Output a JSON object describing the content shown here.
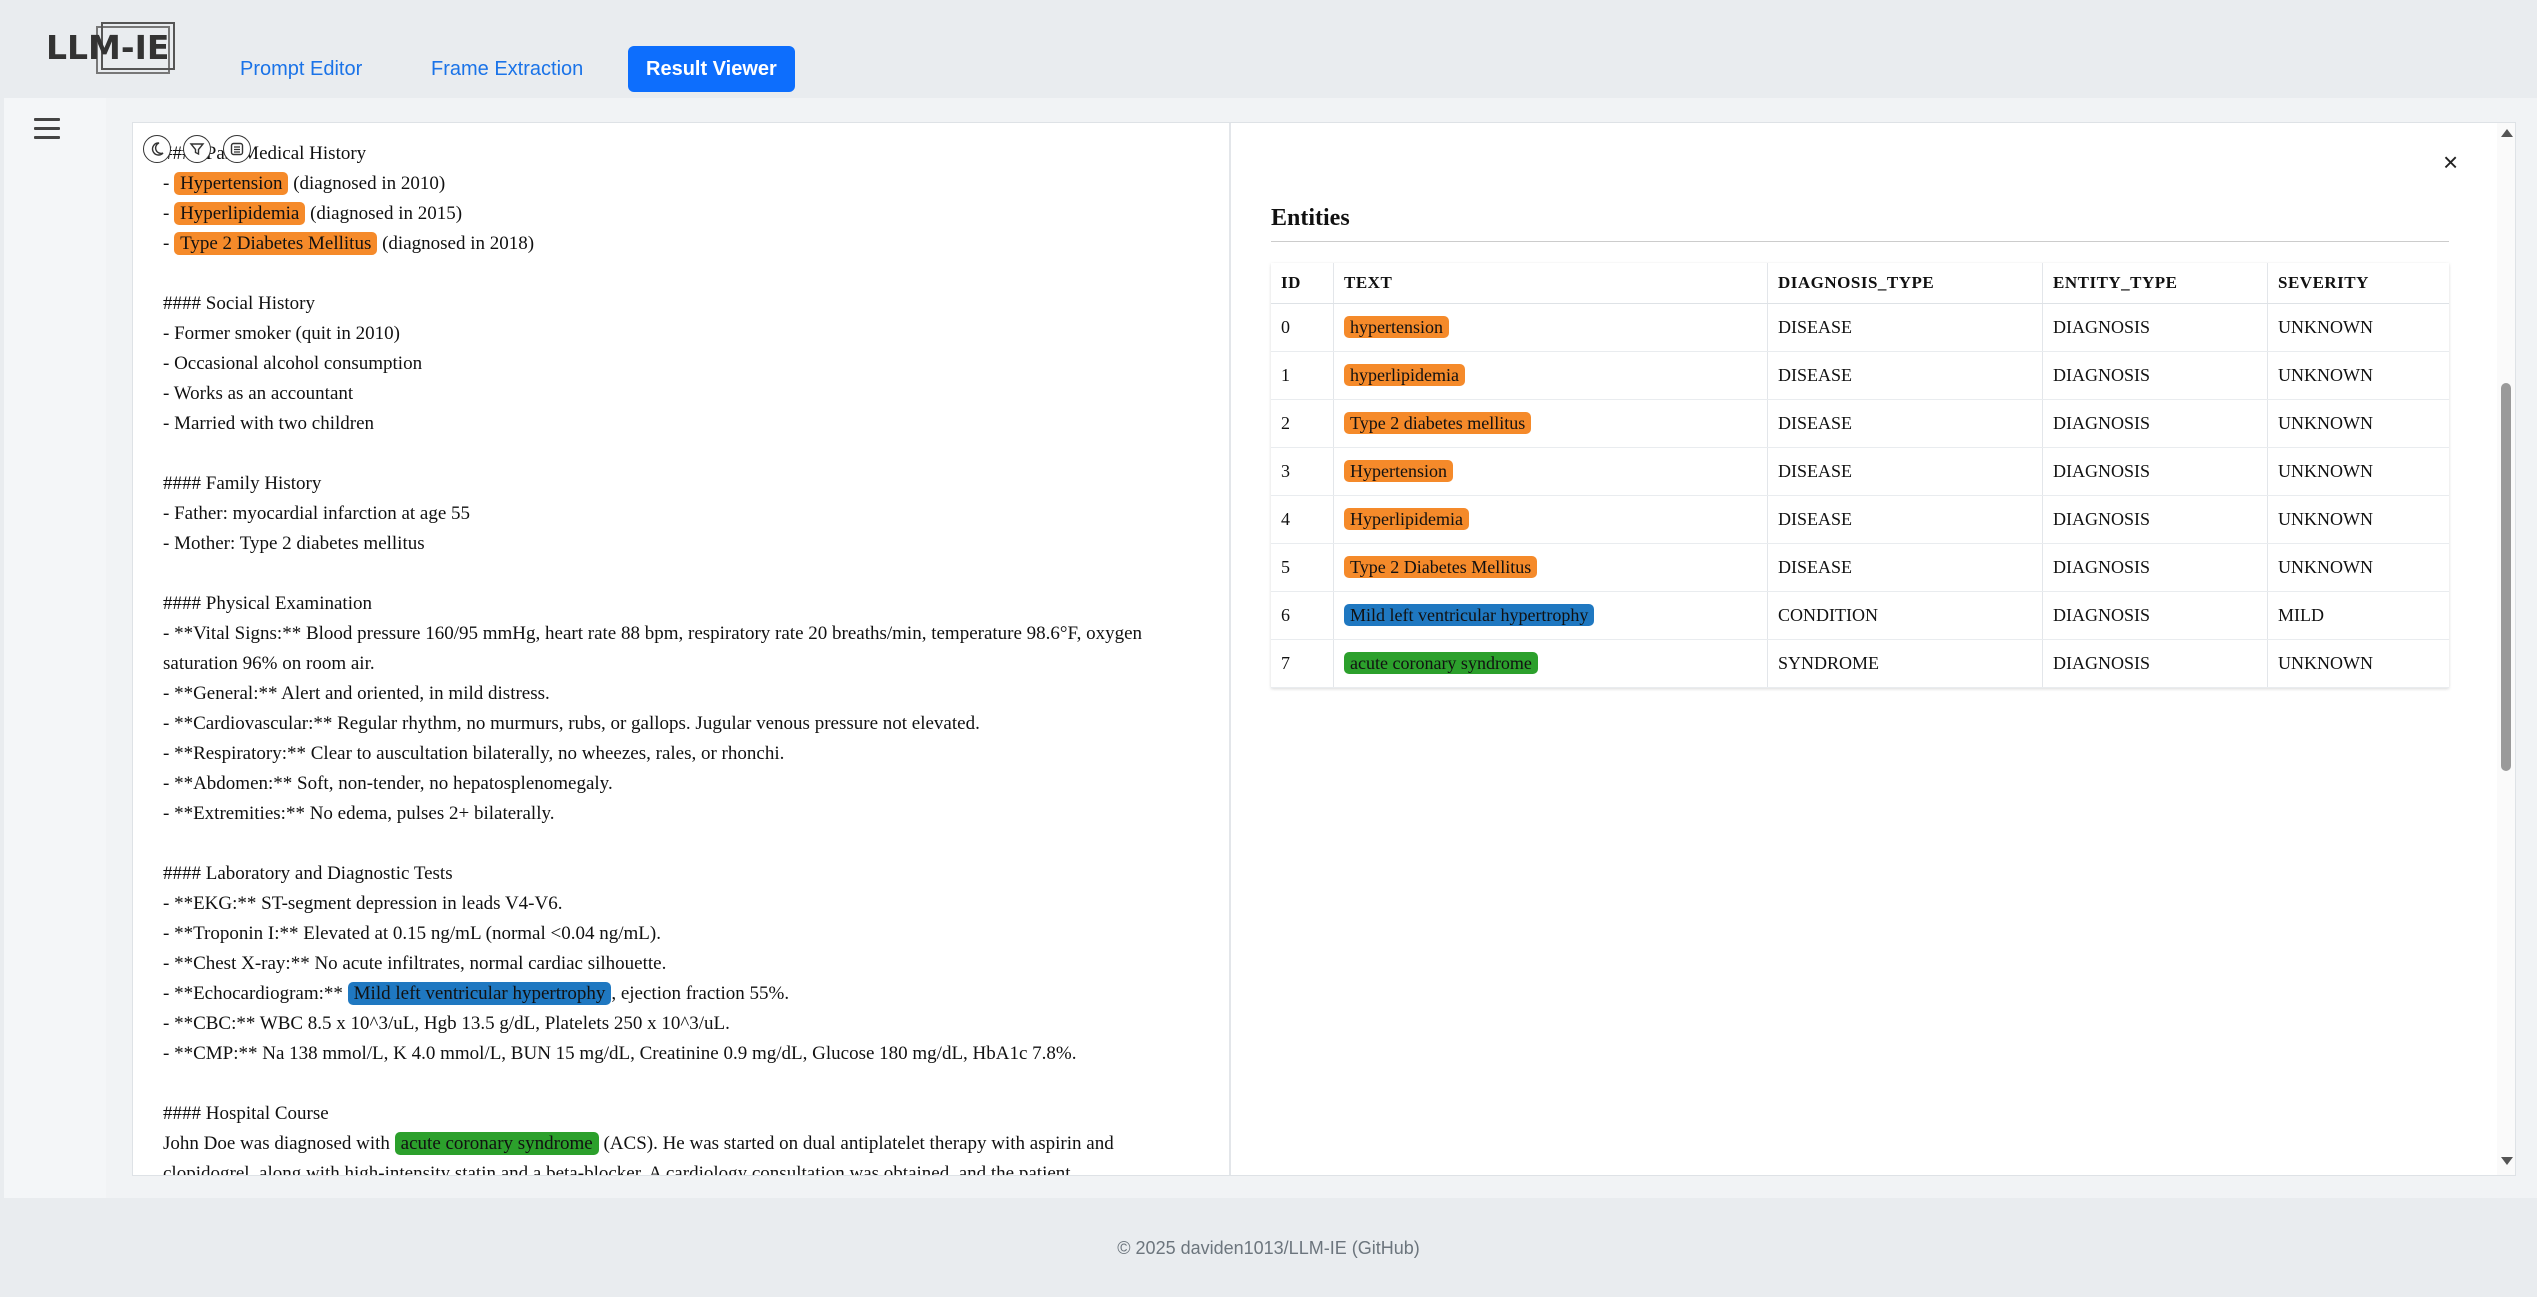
{
  "header": {
    "logo_text": "LLM-IE",
    "tabs": [
      {
        "label": "Prompt Editor",
        "active": false
      },
      {
        "label": "Frame Extraction",
        "active": false
      },
      {
        "label": "Result Viewer",
        "active": true
      }
    ]
  },
  "sidebar": {
    "menu_icon": "hamburger-menu-icon"
  },
  "document_controls": [
    "moon-icon",
    "filter-icon",
    "list-icon"
  ],
  "document": {
    "lines": [
      {
        "segments": [
          {
            "text": "#### Past Medical History"
          }
        ]
      },
      {
        "segments": [
          {
            "text": "- "
          },
          {
            "text": "Hypertension",
            "hl": "orange"
          },
          {
            "text": " (diagnosed in 2010)"
          }
        ]
      },
      {
        "segments": [
          {
            "text": "- "
          },
          {
            "text": "Hyperlipidemia",
            "hl": "orange"
          },
          {
            "text": " (diagnosed in 2015)"
          }
        ]
      },
      {
        "segments": [
          {
            "text": "- "
          },
          {
            "text": "Type 2 Diabetes Mellitus",
            "hl": "orange"
          },
          {
            "text": " (diagnosed in 2018)"
          }
        ]
      },
      {
        "blank": true
      },
      {
        "segments": [
          {
            "text": "#### Social History"
          }
        ]
      },
      {
        "segments": [
          {
            "text": "- Former smoker (quit in 2010)"
          }
        ]
      },
      {
        "segments": [
          {
            "text": "- Occasional alcohol consumption"
          }
        ]
      },
      {
        "segments": [
          {
            "text": "- Works as an accountant"
          }
        ]
      },
      {
        "segments": [
          {
            "text": "- Married with two children"
          }
        ]
      },
      {
        "blank": true
      },
      {
        "segments": [
          {
            "text": "#### Family History"
          }
        ]
      },
      {
        "segments": [
          {
            "text": "- Father: myocardial infarction at age 55"
          }
        ]
      },
      {
        "segments": [
          {
            "text": "- Mother: Type 2 diabetes mellitus"
          }
        ]
      },
      {
        "blank": true
      },
      {
        "segments": [
          {
            "text": "#### Physical Examination"
          }
        ]
      },
      {
        "wrap": true,
        "segments": [
          {
            "text": "- **Vital Signs:** Blood pressure 160/95 mmHg, heart rate 88 bpm, respiratory rate 20 breaths/min, temperature 98.6°F, oxygen saturation 96% on room air."
          }
        ]
      },
      {
        "segments": [
          {
            "text": "- **General:** Alert and oriented, in mild distress."
          }
        ]
      },
      {
        "segments": [
          {
            "text": "- **Cardiovascular:** Regular rhythm, no murmurs, rubs, or gallops. Jugular venous pressure not elevated."
          }
        ]
      },
      {
        "segments": [
          {
            "text": "- **Respiratory:** Clear to auscultation bilaterally, no wheezes, rales, or rhonchi."
          }
        ]
      },
      {
        "segments": [
          {
            "text": "- **Abdomen:** Soft, non-tender, no hepatosplenomegaly."
          }
        ]
      },
      {
        "segments": [
          {
            "text": "- **Extremities:** No edema, pulses 2+ bilaterally."
          }
        ]
      },
      {
        "blank": true
      },
      {
        "segments": [
          {
            "text": "#### Laboratory and Diagnostic Tests"
          }
        ]
      },
      {
        "segments": [
          {
            "text": "- **EKG:** ST-segment depression in leads V4-V6."
          }
        ]
      },
      {
        "segments": [
          {
            "text": "- **Troponin I:** Elevated at 0.15 ng/mL (normal <0.04 ng/mL)."
          }
        ]
      },
      {
        "segments": [
          {
            "text": "- **Chest X-ray:** No acute infiltrates, normal cardiac silhouette."
          }
        ]
      },
      {
        "segments": [
          {
            "text": "- **Echocardiogram:** "
          },
          {
            "text": "Mild left ventricular hypertrophy",
            "hl": "blue"
          },
          {
            "text": ", ejection fraction 55%."
          }
        ]
      },
      {
        "segments": [
          {
            "text": "- **CBC:** WBC 8.5 x 10^3/uL, Hgb 13.5 g/dL, Platelets 250 x 10^3/uL."
          }
        ]
      },
      {
        "segments": [
          {
            "text": "- **CMP:** Na 138 mmol/L, K 4.0 mmol/L, BUN 15 mg/dL, Creatinine 0.9 mg/dL, Glucose 180 mg/dL, HbA1c 7.8%."
          }
        ]
      },
      {
        "blank": true
      },
      {
        "segments": [
          {
            "text": "#### Hospital Course"
          }
        ]
      },
      {
        "segments": [
          {
            "text": "John Doe was diagnosed with "
          },
          {
            "text": "acute coronary syndrome",
            "hl": "green"
          },
          {
            "text": " (ACS). He was started on dual antiplatelet therapy with aspirin and"
          }
        ]
      },
      {
        "segments": [
          {
            "text": "clopidogrel, along with high-intensity statin and a beta-blocker. A cardiology consultation was obtained, and the patient"
          }
        ]
      }
    ]
  },
  "entities": {
    "title": "Entities",
    "close_label": "×",
    "columns": [
      "ID",
      "TEXT",
      "DIAGNOSIS_TYPE",
      "ENTITY_TYPE",
      "SEVERITY"
    ],
    "rows": [
      {
        "id": "0",
        "text": "hypertension",
        "hl": "orange",
        "diagnosis_type": "DISEASE",
        "entity_type": "DIAGNOSIS",
        "severity": "UNKNOWN"
      },
      {
        "id": "1",
        "text": "hyperlipidemia",
        "hl": "orange",
        "diagnosis_type": "DISEASE",
        "entity_type": "DIAGNOSIS",
        "severity": "UNKNOWN"
      },
      {
        "id": "2",
        "text": "Type 2 diabetes mellitus",
        "hl": "orange",
        "diagnosis_type": "DISEASE",
        "entity_type": "DIAGNOSIS",
        "severity": "UNKNOWN"
      },
      {
        "id": "3",
        "text": "Hypertension",
        "hl": "orange",
        "diagnosis_type": "DISEASE",
        "entity_type": "DIAGNOSIS",
        "severity": "UNKNOWN"
      },
      {
        "id": "4",
        "text": "Hyperlipidemia",
        "hl": "orange",
        "diagnosis_type": "DISEASE",
        "entity_type": "DIAGNOSIS",
        "severity": "UNKNOWN"
      },
      {
        "id": "5",
        "text": "Type 2 Diabetes Mellitus",
        "hl": "orange",
        "diagnosis_type": "DISEASE",
        "entity_type": "DIAGNOSIS",
        "severity": "UNKNOWN"
      },
      {
        "id": "6",
        "text": "Mild left ventricular hypertrophy",
        "hl": "blue",
        "diagnosis_type": "CONDITION",
        "entity_type": "DIAGNOSIS",
        "severity": "MILD"
      },
      {
        "id": "7",
        "text": "acute coronary syndrome",
        "hl": "green",
        "diagnosis_type": "SYNDROME",
        "entity_type": "DIAGNOSIS",
        "severity": "UNKNOWN"
      }
    ]
  },
  "colors": {
    "accent": "#0d6efd",
    "orange": "#f58a2a",
    "blue": "#1f78c1",
    "green": "#2ca02c"
  },
  "footer": {
    "text": "© 2025 daviden1013/LLM-IE (GitHub)"
  }
}
